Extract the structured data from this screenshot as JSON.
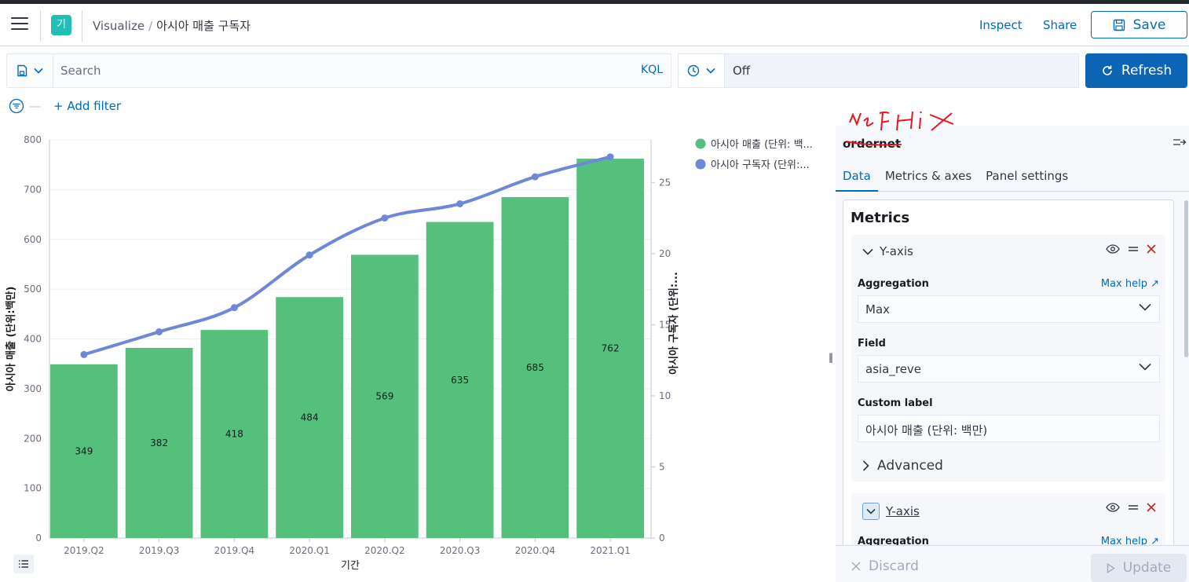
{
  "header": {
    "space_initial": "기",
    "breadcrumb_root": "Visualize",
    "breadcrumb_current": "아시아 매출 구독자",
    "inspect": "Inspect",
    "share": "Share",
    "save": "Save"
  },
  "query": {
    "placeholder": "Search",
    "language": "KQL",
    "refresh_interval": "Off",
    "refresh_label": "Refresh",
    "add_filter": "+ Add filter"
  },
  "chart_data": {
    "type": "bar",
    "categories": [
      "2019.Q2",
      "2019.Q3",
      "2019.Q4",
      "2020.Q1",
      "2020.Q2",
      "2020.Q3",
      "2020.Q4",
      "2021.Q1"
    ],
    "series": [
      {
        "name": "아시아 매출 (단위: 백...",
        "type": "bar",
        "axis": "left",
        "color": "#54c07b",
        "values": [
          349,
          382,
          418,
          484,
          569,
          635,
          685,
          762
        ]
      },
      {
        "name": "아시아 구독자 (단위:...",
        "type": "line",
        "axis": "right",
        "color": "#6e87d6",
        "values": [
          12.9,
          14.5,
          16.2,
          19.9,
          22.5,
          23.5,
          25.4,
          26.8
        ]
      }
    ],
    "xlabel": "기간",
    "ylabel_left": "아시아 매출 (단위:백만)",
    "ylabel_right": "아시아 구독자 (단위:...",
    "ylim_left": [
      0,
      800
    ],
    "yticks_left": [
      0,
      100,
      200,
      300,
      400,
      500,
      600,
      700,
      800
    ],
    "ylim_right": [
      0,
      28
    ],
    "yticks_right": [
      0,
      5,
      10,
      15,
      20,
      25
    ],
    "legend": "top-right",
    "grid": true
  },
  "panel": {
    "index_pattern": "ordernet",
    "tabs": [
      "Data",
      "Metrics & axes",
      "Panel settings"
    ],
    "metrics_title": "Metrics",
    "agg1": {
      "title": "Y-axis",
      "aggregation_label": "Aggregation",
      "aggregation_value": "Max",
      "help": "Max help",
      "field_label": "Field",
      "field_value": "asia_reve",
      "custom_label_label": "Custom label",
      "custom_label_value": "아시아 매출 (단위: 백만)",
      "advanced": "Advanced"
    },
    "agg2": {
      "title": "Y-axis",
      "aggregation_label": "Aggregation",
      "help": "Max help"
    },
    "discard": "Discard",
    "update": "Update"
  },
  "annotation_text": "NeFlix",
  "colors": {
    "accent": "#006bb8",
    "bar": "#54c07b",
    "line": "#6e87d6",
    "refresh": "#0b64b4",
    "annotation": "#e8141e"
  }
}
